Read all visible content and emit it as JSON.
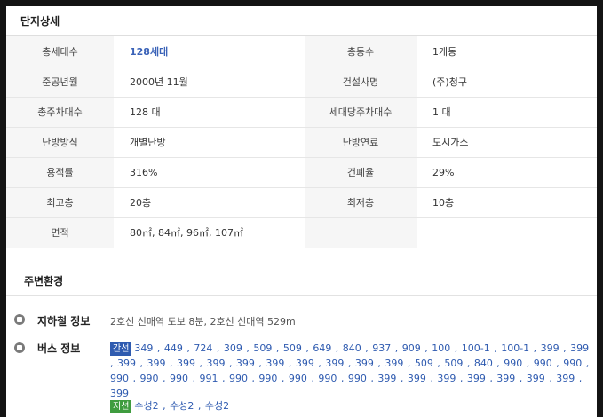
{
  "complex": {
    "title": "단지상세",
    "rows": [
      {
        "l1": "총세대수",
        "v1": "128세대",
        "l2": "총동수",
        "v2": "1개동"
      },
      {
        "l1": "준공년월",
        "v1": "2000년 11월",
        "l2": "건설사명",
        "v2": "(주)청구"
      },
      {
        "l1": "총주차대수",
        "v1": "128 대",
        "l2": "세대당주차대수",
        "v2": "1 대"
      },
      {
        "l1": "난방방식",
        "v1": "개별난방",
        "l2": "난방연료",
        "v2": "도시가스"
      },
      {
        "l1": "용적률",
        "v1": "316%",
        "l2": "건폐율",
        "v2": "29%"
      },
      {
        "l1": "최고층",
        "v1": "20층",
        "l2": "최저층",
        "v2": "10층"
      },
      {
        "l1": "면적",
        "v1": "80㎡, 84㎡, 96㎡, 107㎡",
        "l2": "",
        "v2": ""
      }
    ]
  },
  "surroundings": {
    "title": "주변환경",
    "subway": {
      "icon": "subway-icon",
      "label": "지하철 정보",
      "value": "2호선 신매역 도보 8분, 2호선 신매역 529m"
    },
    "bus": {
      "icon": "bus-icon",
      "label": "버스 정보",
      "main_tag": "간선",
      "main_routes": "349 , 449 , 724 , 309 , 509 , 509 , 649 , 840 , 937 , 909 , 100 , 100-1 , 100-1 , 399 , 399 , 399 , 399 , 399 , 399 , 399 , 399 , 399 , 399 , 399 , 399 , 509 , 509 , 840 , 990 , 990 , 990 , 990 , 990 , 990 , 991 , 990 , 990 , 990 , 990 , 990 , 399 , 399 , 399 , 399 , 399 , 399 , 399 , 399",
      "branch_tag": "지선",
      "branch_routes": "수성2 , 수성2 , 수성2"
    }
  },
  "colors": {
    "accent": "#3b63b8",
    "main_tag": "#2f5bb0",
    "branch_tag": "#3f9c3f"
  }
}
